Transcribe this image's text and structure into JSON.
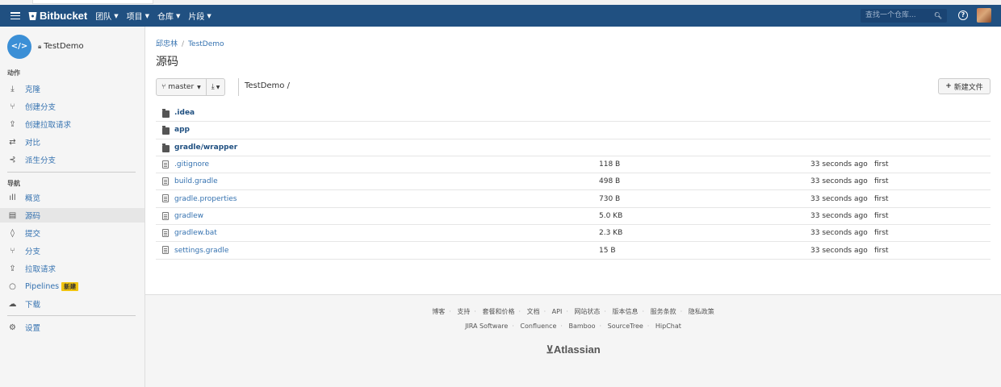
{
  "navbar": {
    "brand": "Bitbucket",
    "menus": [
      "团队",
      "项目",
      "仓库",
      "片段"
    ],
    "search_placeholder": "查找一个仓库..."
  },
  "sidebar": {
    "repo_name": "TestDemo",
    "actions_label": "动作",
    "actions": [
      {
        "label": "克隆",
        "icon": "download-icon"
      },
      {
        "label": "创建分支",
        "icon": "branch-create-icon"
      },
      {
        "label": "创建拉取请求",
        "icon": "pull-request-create-icon"
      },
      {
        "label": "对比",
        "icon": "compare-icon"
      },
      {
        "label": "派生分支",
        "icon": "fork-icon"
      }
    ],
    "nav_label": "导航",
    "nav": [
      {
        "label": "概览",
        "icon": "bar-chart-icon"
      },
      {
        "label": "源码",
        "icon": "source-icon",
        "active": true
      },
      {
        "label": "提交",
        "icon": "commit-icon"
      },
      {
        "label": "分支",
        "icon": "branch-icon"
      },
      {
        "label": "拉取请求",
        "icon": "pull-request-icon"
      },
      {
        "label": "Pipelines",
        "icon": "pipelines-icon",
        "badge": "新建"
      },
      {
        "label": "下载",
        "icon": "cloud-download-icon"
      }
    ],
    "settings": {
      "label": "设置",
      "icon": "gear-icon"
    }
  },
  "main": {
    "breadcrumb": {
      "owner": "邱忠林",
      "repo": "TestDemo"
    },
    "title": "源码",
    "branch": "master",
    "path": "TestDemo /",
    "new_file_label": "新建文件",
    "files": [
      {
        "name": ".idea",
        "type": "dir",
        "size": "",
        "time": "",
        "commit": ""
      },
      {
        "name": "app",
        "type": "dir",
        "size": "",
        "time": "",
        "commit": ""
      },
      {
        "name": "gradle/wrapper",
        "type": "dir",
        "size": "",
        "time": "",
        "commit": ""
      },
      {
        "name": ".gitignore",
        "type": "file",
        "size": "118 B",
        "time": "33 seconds ago",
        "commit": "first"
      },
      {
        "name": "build.gradle",
        "type": "file",
        "size": "498 B",
        "time": "33 seconds ago",
        "commit": "first"
      },
      {
        "name": "gradle.properties",
        "type": "file",
        "size": "730 B",
        "time": "33 seconds ago",
        "commit": "first"
      },
      {
        "name": "gradlew",
        "type": "file",
        "size": "5.0 KB",
        "time": "33 seconds ago",
        "commit": "first"
      },
      {
        "name": "gradlew.bat",
        "type": "file",
        "size": "2.3 KB",
        "time": "33 seconds ago",
        "commit": "first"
      },
      {
        "name": "settings.gradle",
        "type": "file",
        "size": "15 B",
        "time": "33 seconds ago",
        "commit": "first"
      }
    ]
  },
  "footer": {
    "links1": [
      "博客",
      "支持",
      "套餐和价格",
      "文档",
      "API",
      "网站状态",
      "版本信息",
      "服务条款",
      "隐私政策"
    ],
    "links2": [
      "JIRA Software",
      "Confluence",
      "Bamboo",
      "SourceTree",
      "HipChat"
    ],
    "brand": "Atlassian"
  }
}
